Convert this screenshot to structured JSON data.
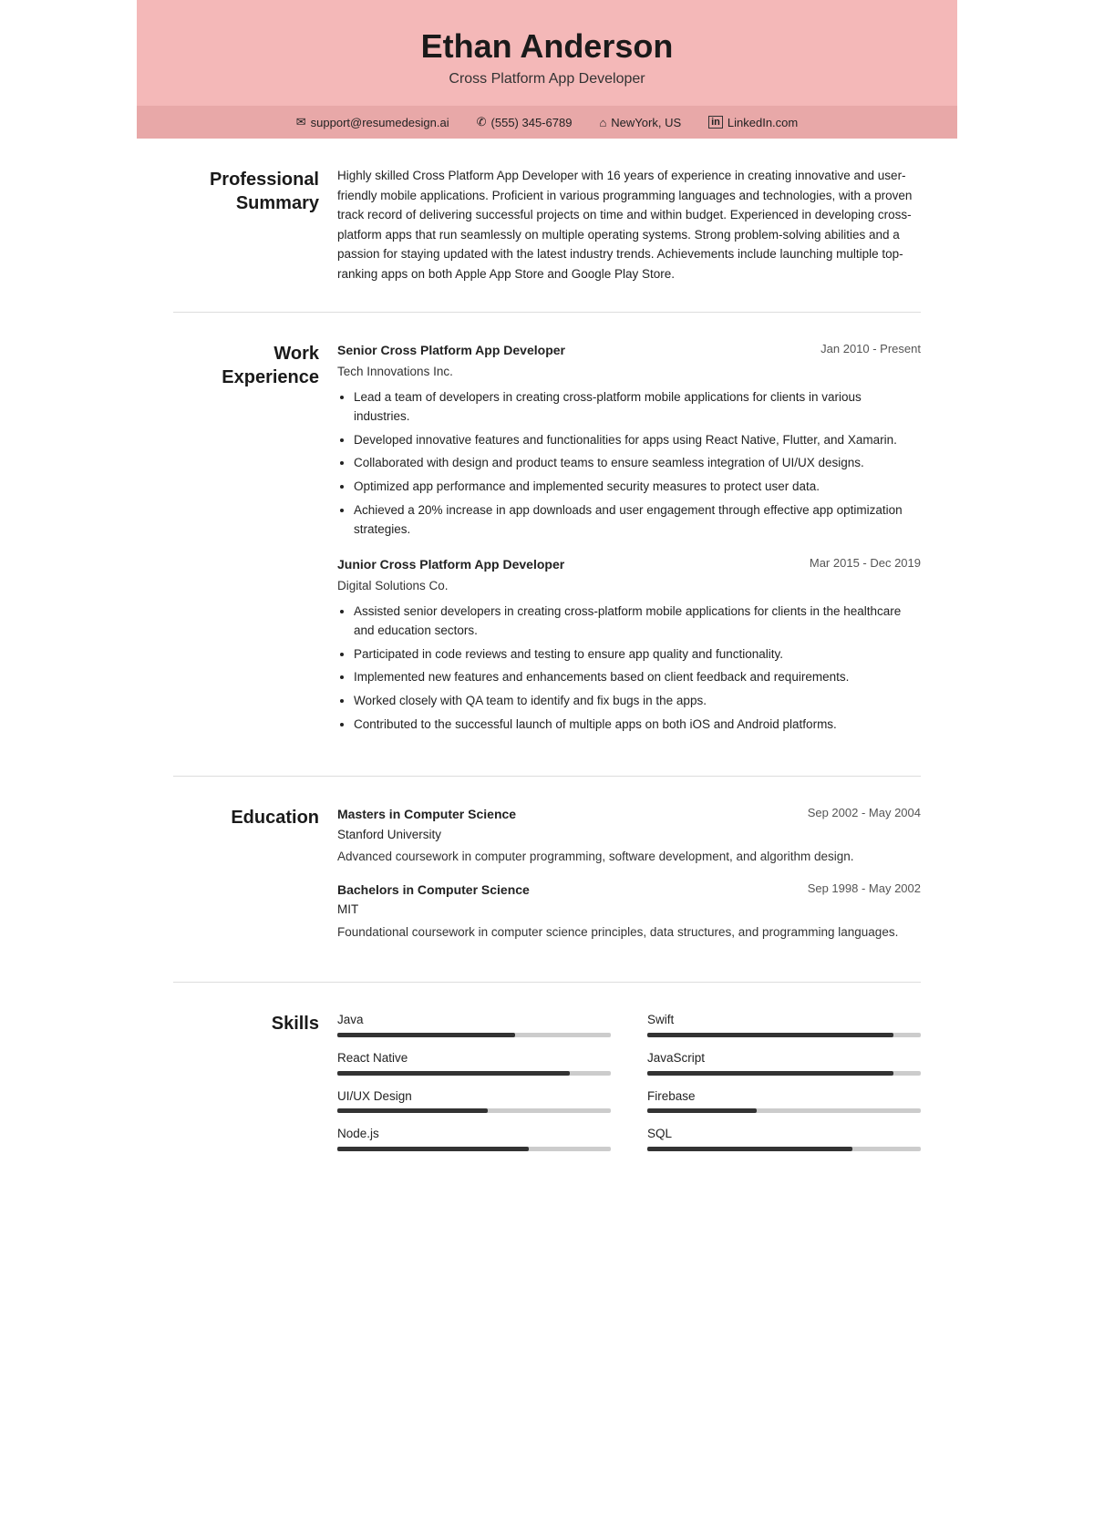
{
  "header": {
    "name": "Ethan Anderson",
    "title": "Cross Platform App Developer"
  },
  "contact": {
    "email": "support@resumedesign.ai",
    "phone": "(555) 345-6789",
    "location": "NewYork, US",
    "linkedin": "LinkedIn.com"
  },
  "sections": {
    "summary": {
      "label": "Professional Summary",
      "text": "Highly skilled Cross Platform App Developer with 16 years of experience in creating innovative and user-friendly mobile applications. Proficient in various programming languages and technologies, with a proven track record of delivering successful projects on time and within budget. Experienced in developing cross-platform apps that run seamlessly on multiple operating systems. Strong problem-solving abilities and a passion for staying updated with the latest industry trends. Achievements include launching multiple top-ranking apps on both Apple App Store and Google Play Store."
    },
    "work": {
      "label": "Work Experience",
      "jobs": [
        {
          "title": "Senior Cross Platform App Developer",
          "company": "Tech Innovations Inc.",
          "date": "Jan 2010 - Present",
          "bullets": [
            "Lead a team of developers in creating cross-platform mobile applications for clients in various industries.",
            "Developed innovative features and functionalities for apps using React Native, Flutter, and Xamarin.",
            "Collaborated with design and product teams to ensure seamless integration of UI/UX designs.",
            "Optimized app performance and implemented security measures to protect user data.",
            "Achieved a 20% increase in app downloads and user engagement through effective app optimization strategies."
          ]
        },
        {
          "title": "Junior Cross Platform App Developer",
          "company": "Digital Solutions Co.",
          "date": "Mar 2015 - Dec 2019",
          "bullets": [
            "Assisted senior developers in creating cross-platform mobile applications for clients in the healthcare and education sectors.",
            "Participated in code reviews and testing to ensure app quality and functionality.",
            "Implemented new features and enhancements based on client feedback and requirements.",
            "Worked closely with QA team to identify and fix bugs in the apps.",
            "Contributed to the successful launch of multiple apps on both iOS and Android platforms."
          ]
        }
      ]
    },
    "education": {
      "label": "Education",
      "items": [
        {
          "degree": "Masters in Computer Science",
          "school": "Stanford University",
          "date": "Sep 2002 - May 2004",
          "desc": "Advanced coursework in computer programming, software development, and algorithm design."
        },
        {
          "degree": "Bachelors in Computer Science",
          "school": "MIT",
          "date": "Sep 1998 - May 2002",
          "desc": "Foundational coursework in computer science principles, data structures, and programming languages."
        }
      ]
    },
    "skills": {
      "label": "Skills",
      "items": [
        {
          "name": "Java",
          "level": 65
        },
        {
          "name": "Swift",
          "level": 90
        },
        {
          "name": "React Native",
          "level": 85
        },
        {
          "name": "JavaScript",
          "level": 90
        },
        {
          "name": "UI/UX Design",
          "level": 55
        },
        {
          "name": "Firebase",
          "level": 40
        },
        {
          "name": "Node.js",
          "level": 70
        },
        {
          "name": "SQL",
          "level": 75
        }
      ]
    }
  },
  "icons": {
    "email": "✉",
    "phone": "✆",
    "location": "⌂",
    "linkedin": "in"
  }
}
